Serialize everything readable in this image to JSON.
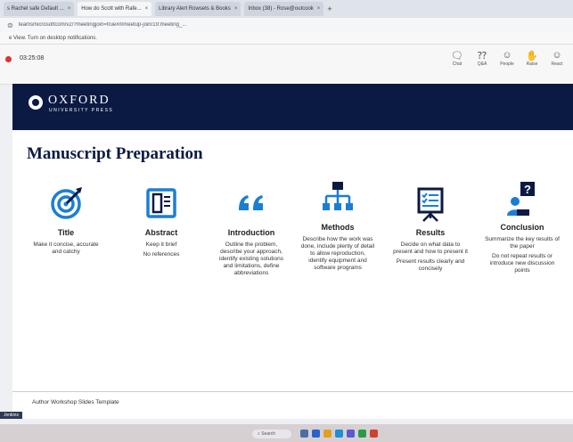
{
  "browser": {
    "tabs": [
      {
        "label": "s Rachel safe Default ..."
      },
      {
        "label": "How do Scott with Rafe..."
      },
      {
        "label": "Library Alert Rowsets & Books"
      },
      {
        "label": "Inbox (38) - Rose@outcook"
      }
    ],
    "address": "teamsmicrosoftcom/v2/?meetingjoin=true#/l/meetup-join/19:meeting_...",
    "notification": "e View. Turn on desktop notifications."
  },
  "meeting": {
    "timer": "03:25:08",
    "tools": [
      {
        "label": "Chat",
        "icon": "chat-icon"
      },
      {
        "label": "Q&A",
        "icon": "qa-icon"
      },
      {
        "label": "People",
        "icon": "people-icon"
      },
      {
        "label": "Raise",
        "icon": "raise-hand-icon"
      },
      {
        "label": "React",
        "icon": "react-icon"
      }
    ]
  },
  "slide": {
    "logo_main": "OXFORD",
    "logo_sub": "UNIVERSITY PRESS",
    "title": "Manuscript Preparation",
    "accent_color": "#1a7fd4",
    "band_color": "#0a1a43",
    "columns": [
      {
        "icon": "target-icon",
        "heading": "Title",
        "body": "Make it concise, accurate and catchy",
        "body2": ""
      },
      {
        "icon": "book-icon",
        "heading": "Abstract",
        "body": "Keep it brief",
        "body2": "No references"
      },
      {
        "icon": "quote-icon",
        "heading": "Introduction",
        "body": "Outline the problem, describe your approach, identify existing solutions and limitations, define abbreviations",
        "body2": ""
      },
      {
        "icon": "hierarchy-icon",
        "heading": "Methods",
        "body": "Describe how the work was done, include plenty of detail to allow reproduction, identify equipment and software programs",
        "body2": ""
      },
      {
        "icon": "presentation-icon",
        "heading": "Results",
        "body": "Decide on what data to present and how to present it",
        "body2": "Present results clearly and concisely"
      },
      {
        "icon": "question-person-icon",
        "heading": "Conclusion",
        "body": "Summarize the key results of the paper",
        "body2": "Do not repeat results or introduce new discussion points"
      }
    ],
    "footer": "Author Workshop Slides Template"
  },
  "taskbar": {
    "search_placeholder": "Search",
    "corner_label": "Jenkins"
  }
}
